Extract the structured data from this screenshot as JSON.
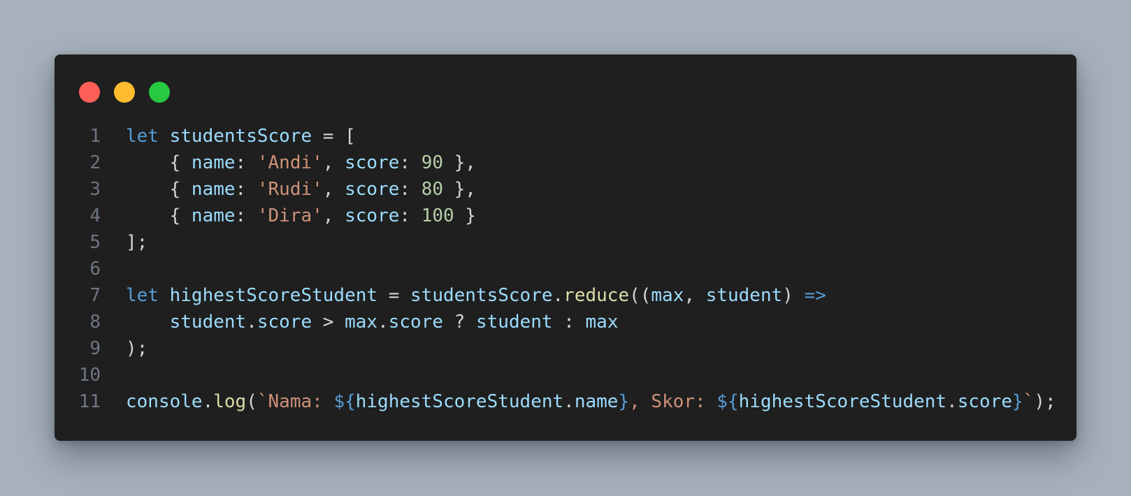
{
  "theme": {
    "page_background": "#a7b1bc",
    "window_background": "#1f1f1f",
    "dot_colors": [
      "#ff5f57",
      "#febc2e",
      "#28c840"
    ],
    "token_colors": {
      "kw": "#569cd6",
      "var": "#9cdcfe",
      "fn": "#dcdcaa",
      "str": "#ce9178",
      "num": "#b5cea8",
      "punc": "#d4d4d4",
      "tpl": "#569cd6"
    }
  },
  "window_controls": [
    {
      "name": "close-dot",
      "color": "#ff5f57"
    },
    {
      "name": "minimize-dot",
      "color": "#febc2e"
    },
    {
      "name": "maximize-dot",
      "color": "#28c840"
    }
  ],
  "code": {
    "language": "javascript",
    "lines": [
      {
        "number": "1",
        "tokens": [
          {
            "t": "kw",
            "v": "let"
          },
          {
            "t": "punc",
            "v": " "
          },
          {
            "t": "var",
            "v": "studentsScore"
          },
          {
            "t": "punc",
            "v": " = ["
          }
        ]
      },
      {
        "number": "2",
        "tokens": [
          {
            "t": "punc",
            "v": "    { "
          },
          {
            "t": "var",
            "v": "name"
          },
          {
            "t": "punc",
            "v": ": "
          },
          {
            "t": "str",
            "v": "'Andi'"
          },
          {
            "t": "punc",
            "v": ", "
          },
          {
            "t": "var",
            "v": "score"
          },
          {
            "t": "punc",
            "v": ": "
          },
          {
            "t": "num",
            "v": "90"
          },
          {
            "t": "punc",
            "v": " },"
          }
        ]
      },
      {
        "number": "3",
        "tokens": [
          {
            "t": "punc",
            "v": "    { "
          },
          {
            "t": "var",
            "v": "name"
          },
          {
            "t": "punc",
            "v": ": "
          },
          {
            "t": "str",
            "v": "'Rudi'"
          },
          {
            "t": "punc",
            "v": ", "
          },
          {
            "t": "var",
            "v": "score"
          },
          {
            "t": "punc",
            "v": ": "
          },
          {
            "t": "num",
            "v": "80"
          },
          {
            "t": "punc",
            "v": " },"
          }
        ]
      },
      {
        "number": "4",
        "tokens": [
          {
            "t": "punc",
            "v": "    { "
          },
          {
            "t": "var",
            "v": "name"
          },
          {
            "t": "punc",
            "v": ": "
          },
          {
            "t": "str",
            "v": "'Dira'"
          },
          {
            "t": "punc",
            "v": ", "
          },
          {
            "t": "var",
            "v": "score"
          },
          {
            "t": "punc",
            "v": ": "
          },
          {
            "t": "num",
            "v": "100"
          },
          {
            "t": "punc",
            "v": " }"
          }
        ]
      },
      {
        "number": "5",
        "tokens": [
          {
            "t": "punc",
            "v": "];"
          }
        ]
      },
      {
        "number": "6",
        "tokens": []
      },
      {
        "number": "7",
        "tokens": [
          {
            "t": "kw",
            "v": "let"
          },
          {
            "t": "punc",
            "v": " "
          },
          {
            "t": "var",
            "v": "highestScoreStudent"
          },
          {
            "t": "punc",
            "v": " = "
          },
          {
            "t": "var",
            "v": "studentsScore"
          },
          {
            "t": "punc",
            "v": "."
          },
          {
            "t": "fn",
            "v": "reduce"
          },
          {
            "t": "punc",
            "v": "(("
          },
          {
            "t": "var",
            "v": "max"
          },
          {
            "t": "punc",
            "v": ", "
          },
          {
            "t": "var",
            "v": "student"
          },
          {
            "t": "punc",
            "v": ") "
          },
          {
            "t": "kw",
            "v": "=>"
          }
        ]
      },
      {
        "number": "8",
        "tokens": [
          {
            "t": "punc",
            "v": "    "
          },
          {
            "t": "var",
            "v": "student"
          },
          {
            "t": "punc",
            "v": "."
          },
          {
            "t": "var",
            "v": "score"
          },
          {
            "t": "punc",
            "v": " > "
          },
          {
            "t": "var",
            "v": "max"
          },
          {
            "t": "punc",
            "v": "."
          },
          {
            "t": "var",
            "v": "score"
          },
          {
            "t": "punc",
            "v": " ? "
          },
          {
            "t": "var",
            "v": "student"
          },
          {
            "t": "punc",
            "v": " : "
          },
          {
            "t": "var",
            "v": "max"
          }
        ]
      },
      {
        "number": "9",
        "tokens": [
          {
            "t": "punc",
            "v": ");"
          }
        ]
      },
      {
        "number": "10",
        "tokens": []
      },
      {
        "number": "11",
        "tokens": [
          {
            "t": "var",
            "v": "console"
          },
          {
            "t": "punc",
            "v": "."
          },
          {
            "t": "fn",
            "v": "log"
          },
          {
            "t": "punc",
            "v": "("
          },
          {
            "t": "str",
            "v": "`Nama: "
          },
          {
            "t": "tpl",
            "v": "${"
          },
          {
            "t": "var",
            "v": "highestScoreStudent"
          },
          {
            "t": "punc",
            "v": "."
          },
          {
            "t": "var",
            "v": "name"
          },
          {
            "t": "tpl",
            "v": "}"
          },
          {
            "t": "str",
            "v": ", Skor: "
          },
          {
            "t": "tpl",
            "v": "${"
          },
          {
            "t": "var",
            "v": "highestScoreStudent"
          },
          {
            "t": "punc",
            "v": "."
          },
          {
            "t": "var",
            "v": "score"
          },
          {
            "t": "tpl",
            "v": "}"
          },
          {
            "t": "str",
            "v": "`"
          },
          {
            "t": "punc",
            "v": ");"
          }
        ]
      }
    ]
  }
}
